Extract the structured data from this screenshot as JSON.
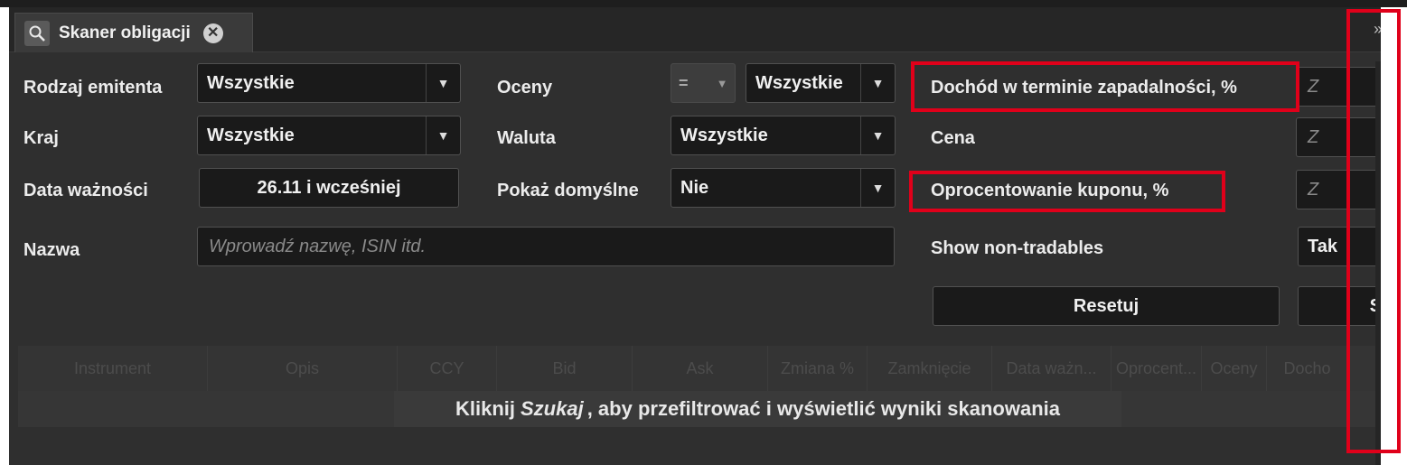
{
  "tab": {
    "title": "Skaner obligacji",
    "close_glyph": "✕",
    "icon": "magnifier-icon",
    "more_glyph": "»"
  },
  "filters": {
    "issuer_type": {
      "label": "Rodzaj emitenta",
      "value": "Wszystkie"
    },
    "country": {
      "label": "Kraj",
      "value": "Wszystkie"
    },
    "expiry": {
      "label": "Data ważności",
      "value": "26.11 i wcześniej"
    },
    "name": {
      "label": "Nazwa",
      "placeholder": "Wprowadź nazwę, ISIN itd."
    },
    "ratings": {
      "label": "Oceny",
      "operator": "=",
      "value": "Wszystkie"
    },
    "currency": {
      "label": "Waluta",
      "value": "Wszystkie"
    },
    "show_default": {
      "label": "Pokaż domyślne",
      "value": "Nie"
    },
    "yield": {
      "label": "Dochód w terminie zapadalności, %",
      "from_placeholder": "Z"
    },
    "price": {
      "label": "Cena",
      "from_placeholder": "Z"
    },
    "coupon": {
      "label": "Oprocentowanie kuponu, %",
      "from_placeholder": "Z"
    },
    "non_tradables": {
      "label": "Show non-tradables",
      "value": "Tak"
    }
  },
  "buttons": {
    "reset": "Resetuj",
    "search_partial": "S"
  },
  "table": {
    "columns": [
      "Instrument",
      "Opis",
      "CCY",
      "Bid",
      "Ask",
      "Zmiana %",
      "Zamknięcie",
      "Data ważn...",
      "Oprocent...",
      "Oceny",
      "Docho"
    ],
    "empty_message_before": "Kliknij",
    "empty_message_em": "Szukaj",
    "empty_message_after": ", aby przefiltrować i wyświetlić wyniki skanowania"
  },
  "colors": {
    "highlight": "#e0001a",
    "panel": "#2f2f2f",
    "field": "#1a1a1a"
  }
}
